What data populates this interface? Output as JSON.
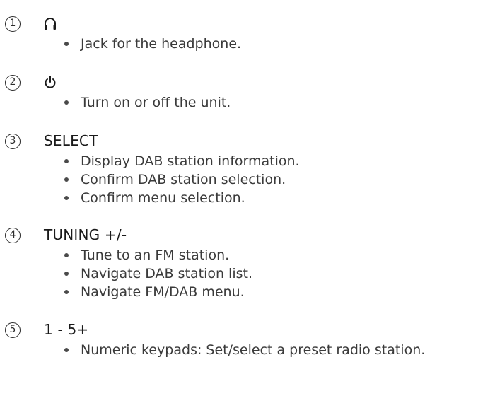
{
  "items": [
    {
      "number": "1",
      "heading": "",
      "icon": "headphone-icon",
      "bullets": [
        "Jack for the headphone."
      ]
    },
    {
      "number": "2",
      "heading": "",
      "icon": "power-icon",
      "bullets": [
        "Turn on or off the unit."
      ]
    },
    {
      "number": "3",
      "heading": "SELECT",
      "icon": "",
      "bullets": [
        "Display DAB station information.",
        "Confirm DAB station selection.",
        "Confirm menu selection."
      ]
    },
    {
      "number": "4",
      "heading": "TUNING +/-",
      "icon": "",
      "bullets": [
        "Tune to an FM station.",
        "Navigate DAB station list.",
        "Navigate FM/DAB menu."
      ]
    },
    {
      "number": "5",
      "heading": "1 - 5+",
      "icon": "",
      "bullets": [
        "Numeric keypads: Set/select a preset radio station."
      ]
    }
  ]
}
